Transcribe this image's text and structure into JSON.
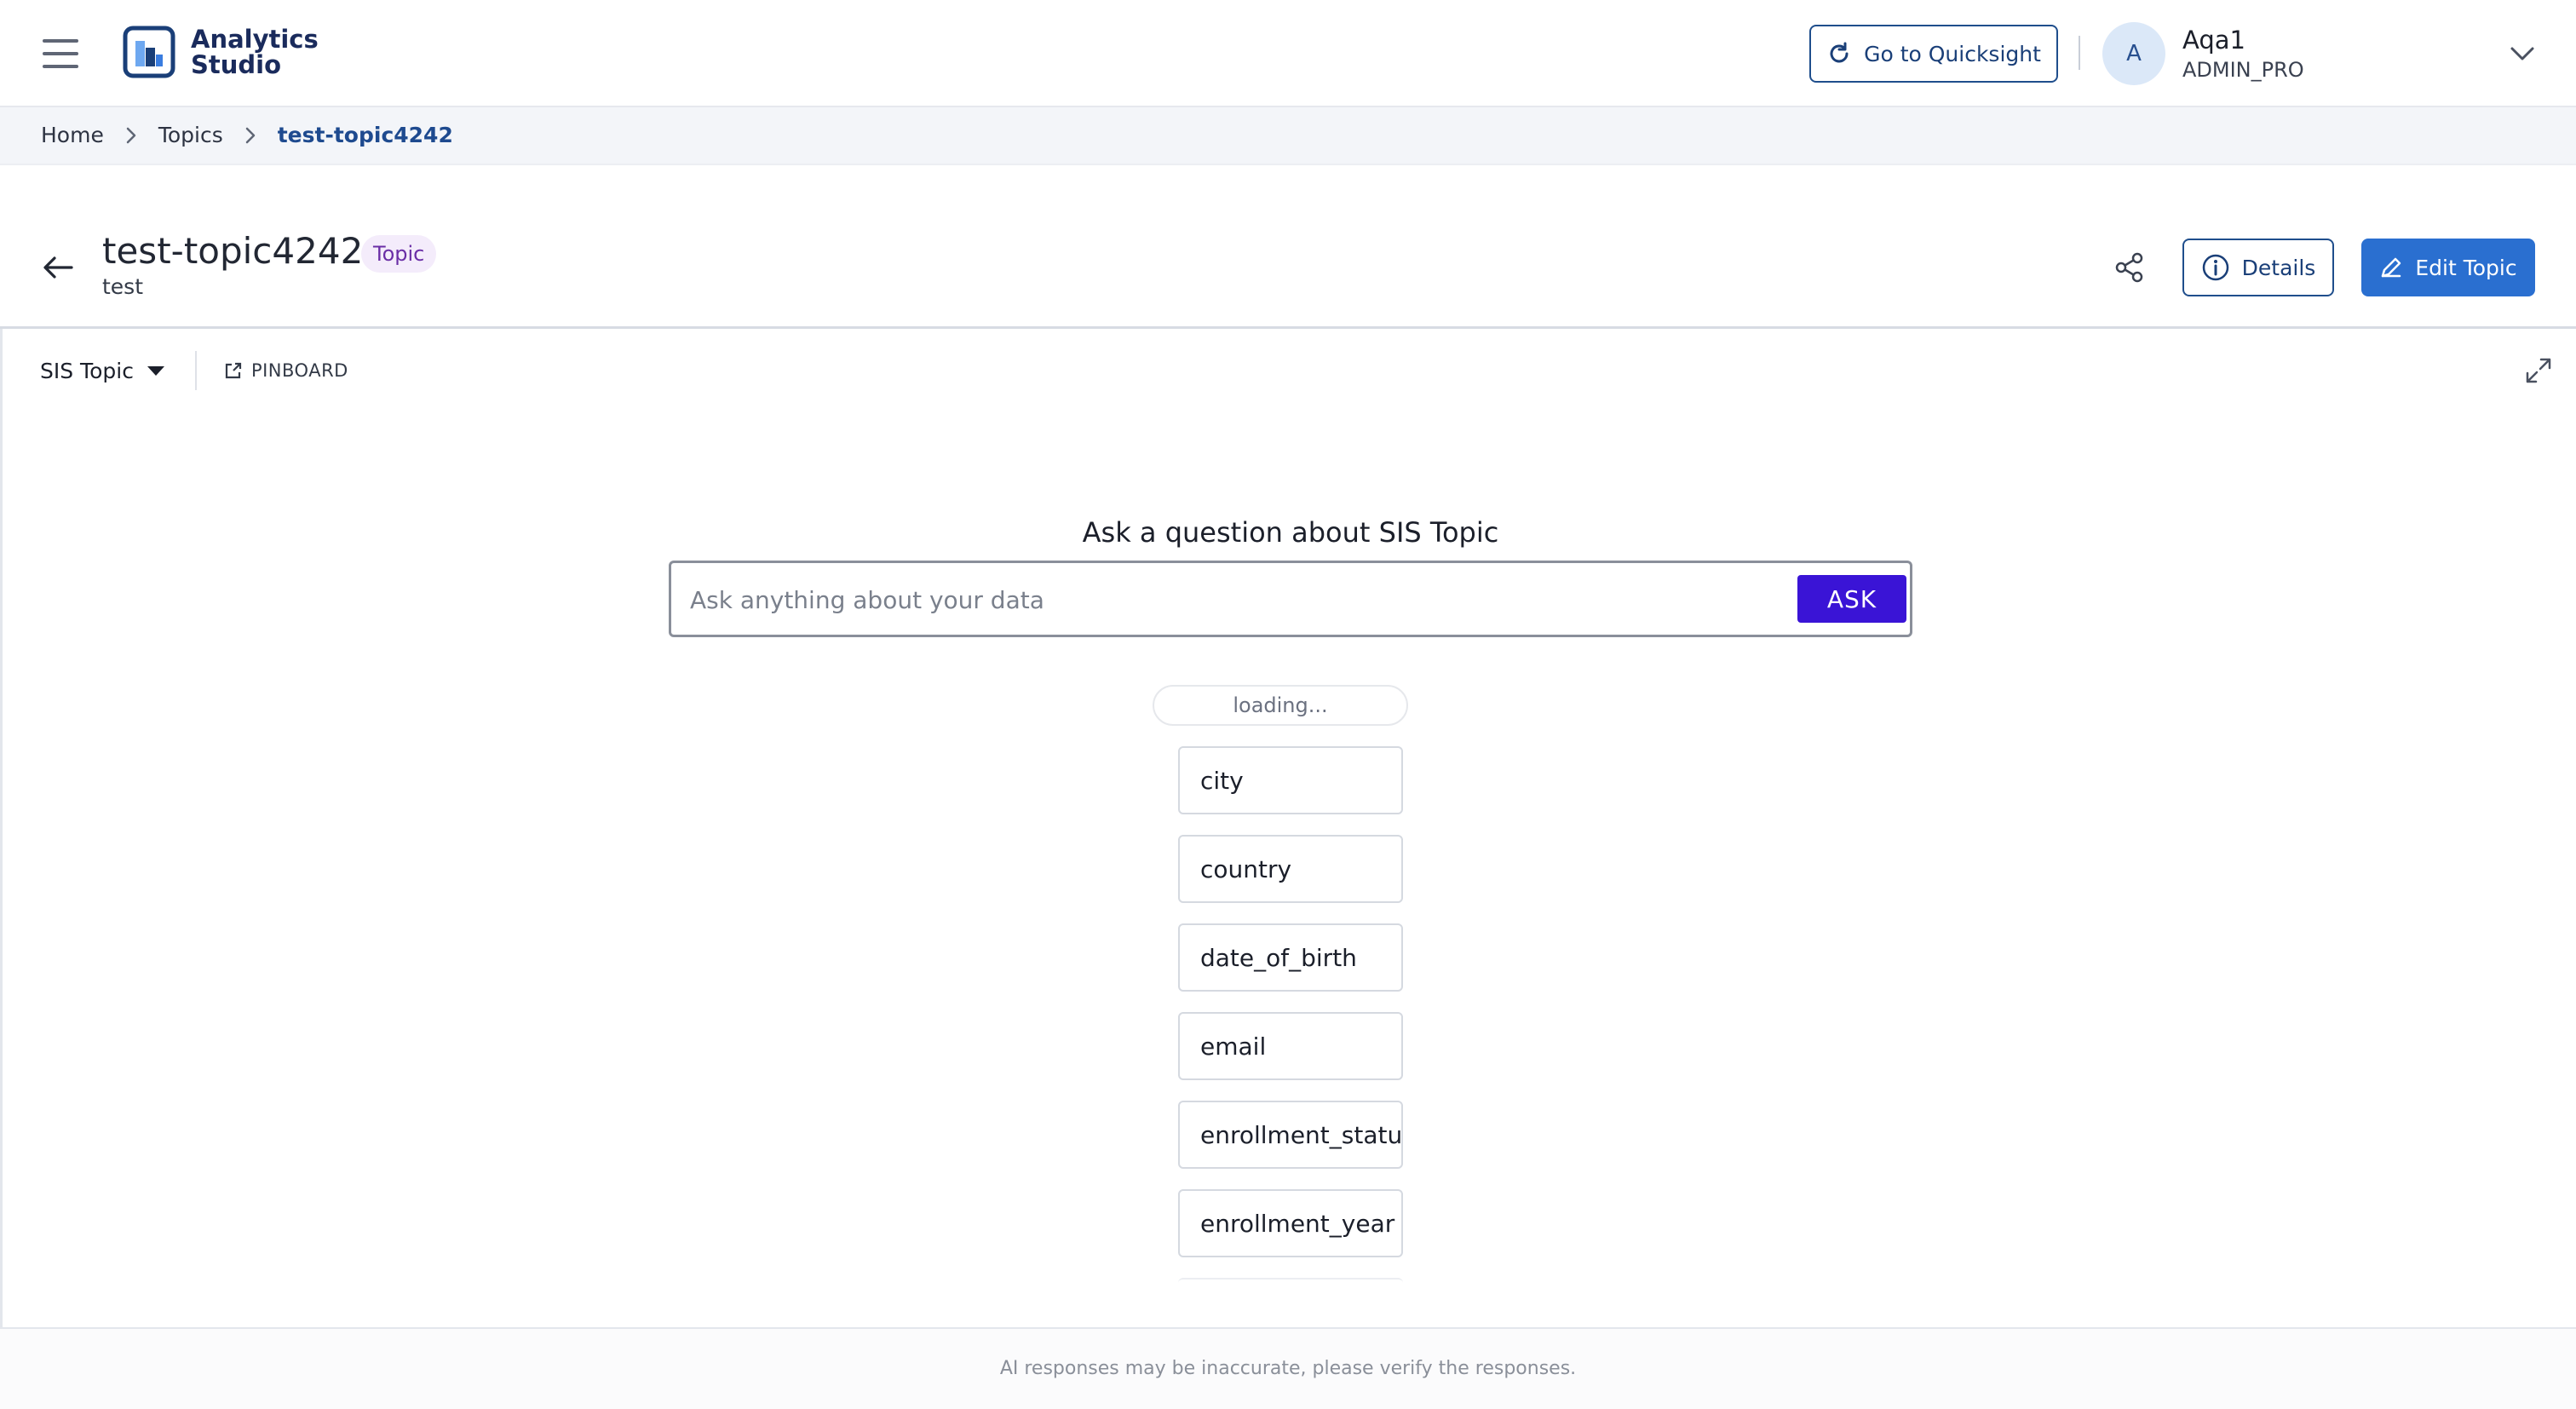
{
  "header": {
    "brand_name": "Analytics Studio",
    "quicksight_label": "Go to Quicksight",
    "user": {
      "initial": "A",
      "name": "Aqa1",
      "role": "ADMIN_PRO"
    }
  },
  "breadcrumb": {
    "items": [
      "Home",
      "Topics",
      "test-topic4242"
    ]
  },
  "page": {
    "title": "test-topic4242",
    "badge": "Topic",
    "subtitle": "test",
    "details_label": "Details",
    "edit_label": "Edit Topic"
  },
  "toolbar": {
    "topic_selected": "SIS Topic",
    "pinboard_label": "PINBOARD"
  },
  "ask": {
    "heading": "Ask a question about SIS Topic",
    "placeholder": "Ask anything about your data",
    "button_label": "ASK",
    "loading_text": "loading..."
  },
  "fields": [
    "city",
    "country",
    "date_of_birth",
    "email",
    "enrollment_status",
    "enrollment_year"
  ],
  "footer": {
    "disclaimer": "AI responses may be inaccurate, please verify the responses."
  },
  "colors": {
    "brand_navy": "#1a2b5c",
    "primary_blue": "#2a6fd0",
    "ask_purple": "#3a14d6",
    "badge_purple": "#6a2ea6",
    "breadcrumb_active": "#1e4a8f"
  },
  "icons": [
    "hamburger-icon",
    "analytics-logo-icon",
    "refresh-icon",
    "chevron-down-icon",
    "chevron-right-icon",
    "back-arrow-icon",
    "share-icon",
    "info-icon",
    "pencil-icon",
    "caret-down-icon",
    "external-link-icon",
    "expand-icon"
  ]
}
